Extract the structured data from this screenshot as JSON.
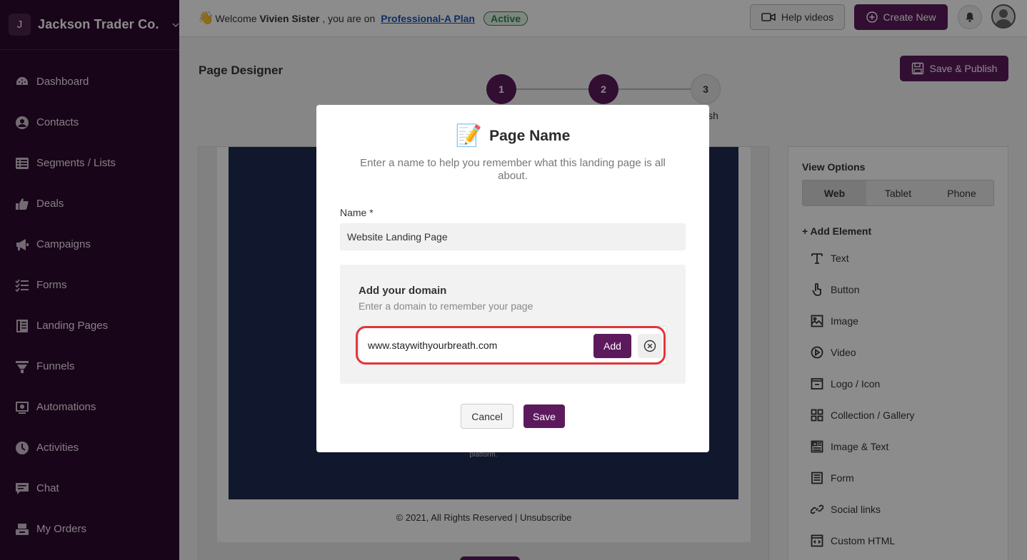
{
  "sidebar": {
    "org_initial": "J",
    "org_name": "Jackson Trader Co.",
    "items": [
      {
        "label": "Dashboard",
        "icon": "dashboard-icon"
      },
      {
        "label": "Contacts",
        "icon": "contacts-icon"
      },
      {
        "label": "Segments / Lists",
        "icon": "list-icon"
      },
      {
        "label": "Deals",
        "icon": "thumbs-up-icon"
      },
      {
        "label": "Campaigns",
        "icon": "megaphone-icon"
      },
      {
        "label": "Forms",
        "icon": "checklist-icon"
      },
      {
        "label": "Landing Pages",
        "icon": "landing-page-icon"
      },
      {
        "label": "Funnels",
        "icon": "funnel-icon"
      },
      {
        "label": "Automations",
        "icon": "automation-icon"
      },
      {
        "label": "Activities",
        "icon": "clock-icon"
      },
      {
        "label": "Chat",
        "icon": "chat-icon"
      },
      {
        "label": "My Orders",
        "icon": "orders-icon"
      }
    ]
  },
  "topbar": {
    "wave": "👋",
    "welcome_prefix": "Welcome",
    "user_name": "Vivien Sister",
    "welcome_suffix": ", you are on",
    "plan": "Professional-A Plan",
    "plan_status": "Active",
    "help_videos": "Help videos",
    "create_new": "Create New"
  },
  "main": {
    "page_title": "Page Designer",
    "save_publish": "Save & Publish",
    "steps": [
      "1",
      "2",
      "3"
    ],
    "step3_label_fragment": "ish",
    "canvas_text": "platform.",
    "footer_text": "© 2021, All Rights Reserved | Unsubscribe"
  },
  "panel": {
    "view_options_title": "View Options",
    "views": [
      "Web",
      "Tablet",
      "Phone"
    ],
    "active_view": "Web",
    "add_element": "+ Add Element",
    "elements": [
      "Text",
      "Button",
      "Image",
      "Video",
      "Logo / Icon",
      "Collection / Gallery",
      "Image & Text",
      "Form",
      "Social links",
      "Custom HTML"
    ]
  },
  "modal": {
    "memo": "📝",
    "title": "Page Name",
    "subtitle": "Enter a name to help you remember what this landing page is all about.",
    "name_label": "Name *",
    "name_value": "Website Landing Page",
    "domain_title": "Add your domain",
    "domain_subtitle": "Enter a domain to remember your page",
    "domain_value": "www.staywithyourbreath.com",
    "add_label": "Add",
    "cancel_label": "Cancel",
    "save_label": "Save"
  },
  "colors": {
    "sidebar_bg": "#2f0a2f",
    "accent": "#5c1a5c",
    "active_green": "#2f8a57",
    "highlight_red": "#e0353a",
    "canvas_navy": "#1f2d52"
  }
}
